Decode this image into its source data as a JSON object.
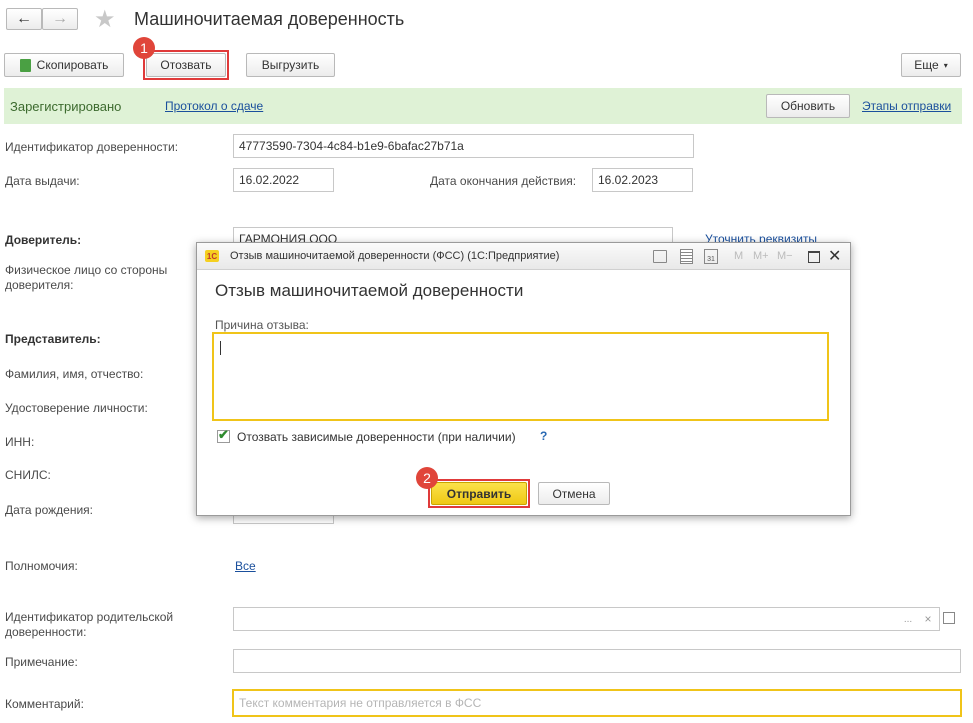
{
  "header": {
    "title": "Машиночитаемая доверенность"
  },
  "toolbar": {
    "copy_label": "Скопировать",
    "revoke_label": "Отозвать",
    "export_label": "Выгрузить",
    "more_label": "Еще"
  },
  "status_bar": {
    "status": "Зарегистрировано",
    "protocol_link": "Протокол о сдаче",
    "refresh_label": "Обновить",
    "stages_link": "Этапы отправки"
  },
  "form": {
    "id_label": "Идентификатор доверенности:",
    "id_value": "47773590-7304-4c84-b1e9-6bafac27b71a",
    "issue_label": "Дата выдачи:",
    "issue_value": "16.02.2022",
    "expiry_label": "Дата окончания действия:",
    "expiry_value": "16.02.2023",
    "principal_label": "Доверитель:",
    "principal_value": "ГАРМОНИЯ ООО",
    "refine_link": "Уточнить реквизиты",
    "person_label": "Физическое лицо со стороны доверителя:",
    "representative_label": "Представитель:",
    "fio_label": "Фамилия, имя, отчество:",
    "identity_label": "Удостоверение личности:",
    "inn_label": "ИНН:",
    "snils_label": "СНИЛС:",
    "birth_label": "Дата рождения:",
    "powers_label": "Полномочия:",
    "powers_link": "Все",
    "parent_label": "Идентификатор родительской доверенности:",
    "note_label": "Примечание:",
    "comment_label": "Комментарий:",
    "comment_placeholder": "Текст комментария не отправляется в ФСС"
  },
  "dialog": {
    "window_title": "Отзыв машиночитаемой доверенности (ФСС)  (1С:Предприятие)",
    "logo_text": "1С",
    "heading": "Отзыв машиночитаемой доверенности",
    "reason_label": "Причина отзыва:",
    "reason_value": "",
    "checkbox_label": "Отозвать зависимые доверенности (при наличии)",
    "help": "?",
    "send_label": "Отправить",
    "cancel_label": "Отмена",
    "tb_m": "M",
    "tb_mplus": "M+",
    "tb_mminus": "M−"
  },
  "badges": {
    "one": "1",
    "two": "2"
  },
  "colors": {
    "status_bg": "#dff2d6",
    "highlight": "#e03a3a",
    "focus": "#f0c419",
    "send_button": "#f6d31d",
    "link": "#1a4f9c"
  }
}
